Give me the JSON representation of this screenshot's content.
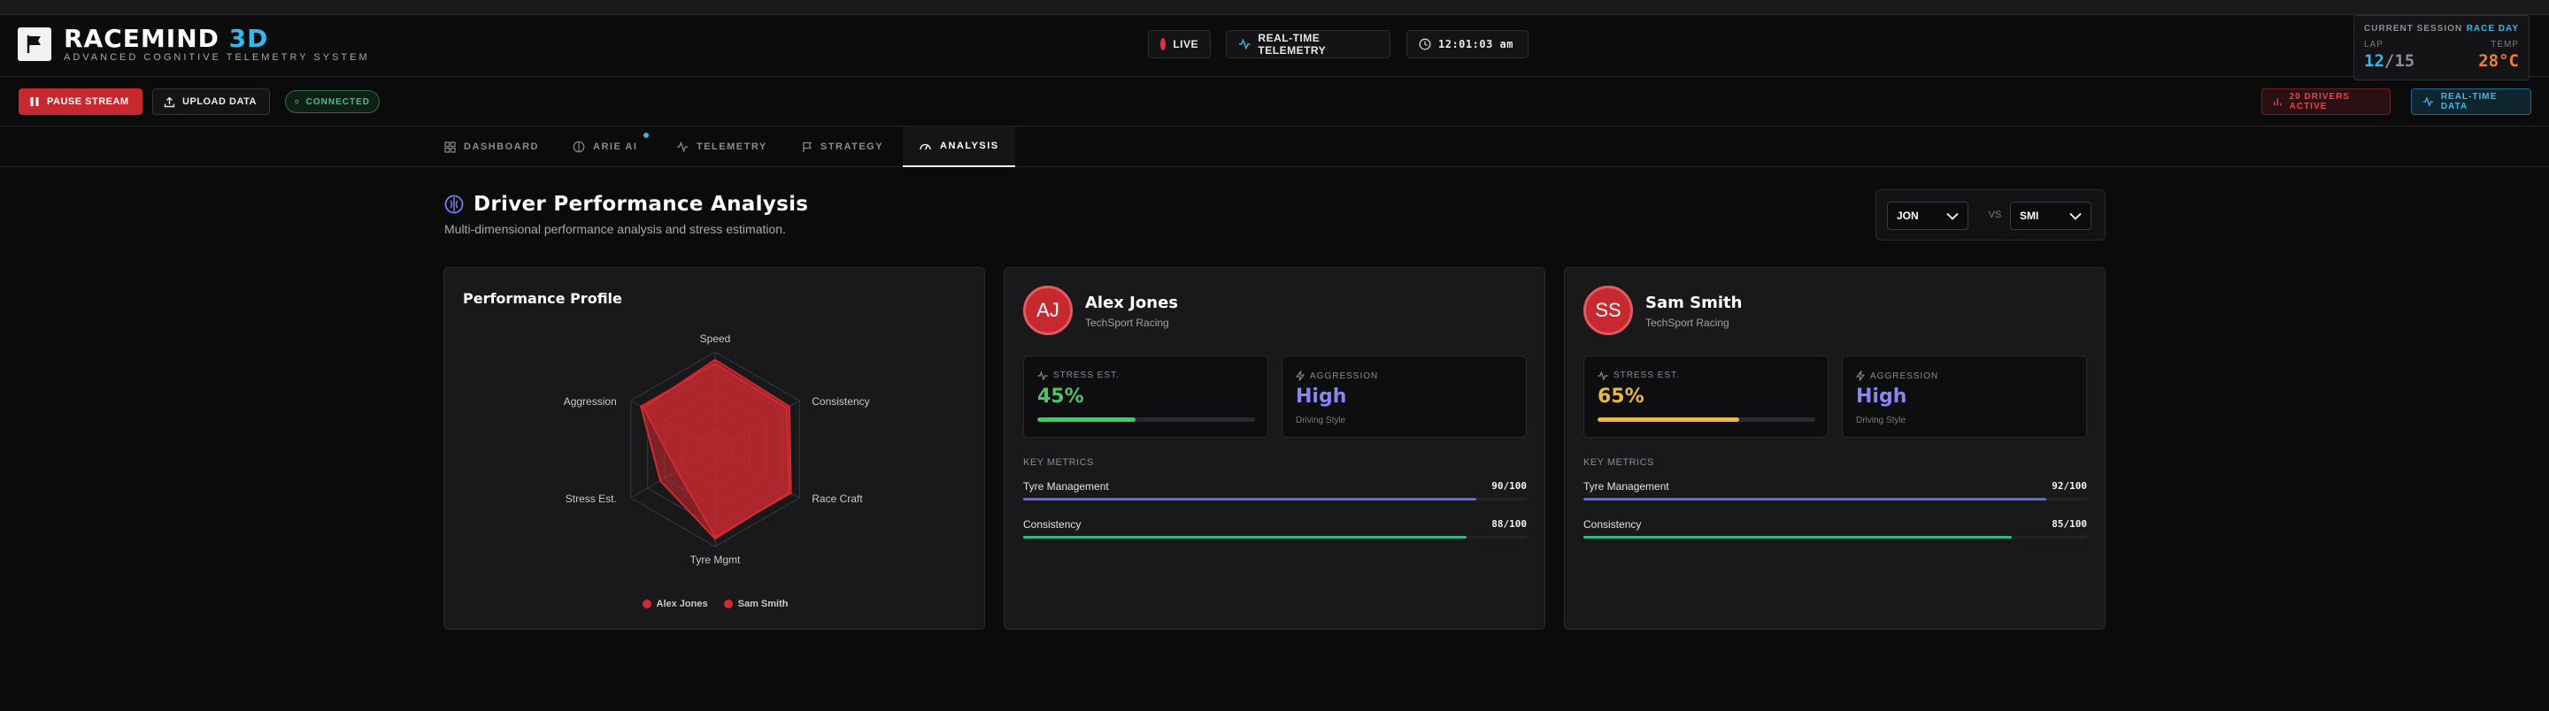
{
  "app": {
    "brand_main": "RACEMIND",
    "brand_accent": "3D",
    "tagline": "ADVANCED COGNITIVE TELEMETRY SYSTEM"
  },
  "header": {
    "live_label": "LIVE",
    "telemetry_label": "REAL-TIME TELEMETRY",
    "clock": "12:01:03 am"
  },
  "session": {
    "label": "CURRENT SESSION",
    "day": "RACE DAY",
    "lap_label": "LAP",
    "lap_current": "12",
    "lap_total": "/15",
    "temp_label": "TEMP",
    "temp_value": "28°C"
  },
  "toolbar": {
    "pause_label": "PAUSE STREAM",
    "upload_label": "UPLOAD DATA",
    "connected_label": "CONNECTED",
    "drivers_label": "20 DRIVERS ACTIVE",
    "realtime_label": "REAL-TIME DATA"
  },
  "tabs": [
    {
      "label": "DASHBOARD",
      "icon": "grid-icon"
    },
    {
      "label": "ARIE AI",
      "icon": "brain-icon"
    },
    {
      "label": "TELEMETRY",
      "icon": "pulse-icon"
    },
    {
      "label": "STRATEGY",
      "icon": "flag-icon"
    },
    {
      "label": "ANALYSIS",
      "icon": "gauge-icon"
    }
  ],
  "page": {
    "title": "Driver Performance Analysis",
    "subtitle": "Multi-dimensional performance analysis and stress estimation."
  },
  "compare": {
    "driver_a": "JON",
    "vs": "VS",
    "driver_b": "SMI"
  },
  "chart_data": {
    "type": "radar",
    "title": "Performance Profile",
    "axes": [
      "Speed",
      "Consistency",
      "Race Craft",
      "Tyre Mgmt",
      "Stress Est.",
      "Aggression"
    ],
    "max": 100,
    "series": [
      {
        "name": "Alex Jones",
        "values": [
          92,
          88,
          90,
          90,
          45,
          85
        ],
        "color": "#d22a32"
      },
      {
        "name": "Sam Smith",
        "values": [
          88,
          85,
          88,
          92,
          65,
          88
        ],
        "color": "#d22a32"
      }
    ]
  },
  "drivers": [
    {
      "initials": "AJ",
      "name": "Alex Jones",
      "team": "TechSport Racing",
      "stress_label": "STRESS EST.",
      "stress_value": "45%",
      "stress_pct": 45,
      "stress_color": "#4fc36a",
      "aggr_label": "AGGRESSION",
      "aggr_value": "High",
      "aggr_sub": "Driving Style",
      "key_metrics_label": "KEY METRICS",
      "metrics": [
        {
          "label": "Tyre Management",
          "value": "90/100",
          "pct": 90,
          "color": "#6366f1"
        },
        {
          "label": "Consistency",
          "value": "88/100",
          "pct": 88,
          "color": "#2fb88a"
        }
      ]
    },
    {
      "initials": "SS",
      "name": "Sam Smith",
      "team": "TechSport Racing",
      "stress_label": "STRESS EST.",
      "stress_value": "65%",
      "stress_pct": 65,
      "stress_color": "#e8b84a",
      "aggr_label": "AGGRESSION",
      "aggr_value": "High",
      "aggr_sub": "Driving Style",
      "key_metrics_label": "KEY METRICS",
      "metrics": [
        {
          "label": "Tyre Management",
          "value": "92/100",
          "pct": 92,
          "color": "#6366f1"
        },
        {
          "label": "Consistency",
          "value": "85/100",
          "pct": 85,
          "color": "#2fb88a"
        }
      ]
    }
  ],
  "colors": {
    "accent": "#38b6e8",
    "danger": "#c8282f",
    "aggression": "#8b84f6"
  }
}
